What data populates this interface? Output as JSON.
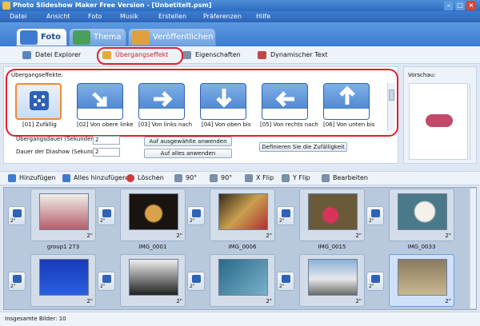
{
  "window": {
    "title": "Photo Slideshow Maker Free Version - [Unbetitelt.psm]"
  },
  "menu": [
    "Datei",
    "Ansicht",
    "Foto",
    "Musik",
    "Erstellen",
    "Präferenzen",
    "Hilfe"
  ],
  "main_tabs": [
    "Foto",
    "Thema",
    "Veröffentlichen"
  ],
  "sub_tabs": [
    "Datei Explorer",
    "Übergangseffekt",
    "Eigenschaften",
    "Dynamischer Text"
  ],
  "transitions": {
    "header": "Übergangseffekte:",
    "items": [
      "[01] Zufällig",
      "[02] Von obere linke",
      "[03] Von links nach",
      "[04] Von oben bis",
      "[05] Von rechts nach",
      "[06] Von unten bis"
    ]
  },
  "settings": {
    "duration_label": "Übergangsdauer (Sekunden):",
    "duration_value": "2",
    "show_label": "Dauer der Diashow (Sekunden):",
    "show_value": "2",
    "apply_selected": "Auf ausgewählte anwenden",
    "apply_all": "Auf alles anwenden",
    "define_random": "Definieren Sie die Zufälligkeit"
  },
  "preview": {
    "label": "Vorschau:"
  },
  "toolbar": [
    "Hinzufügen",
    "Alles hinzufügen",
    "Löschen",
    "90°",
    "90°",
    "X Flip",
    "Y Flip",
    "Bearbeiten"
  ],
  "slides": {
    "duration": "2\"",
    "row1": [
      "group1 273",
      "IMG_0001",
      "IMG_0006",
      "IMG_0015",
      "IMG_0033"
    ],
    "row2": [
      "",
      "",
      "",
      "",
      ""
    ]
  },
  "status": "Insgesamte Bilder: 10",
  "colors": {
    "accent": "#2c6cc0",
    "highlight": "#e0202a"
  }
}
